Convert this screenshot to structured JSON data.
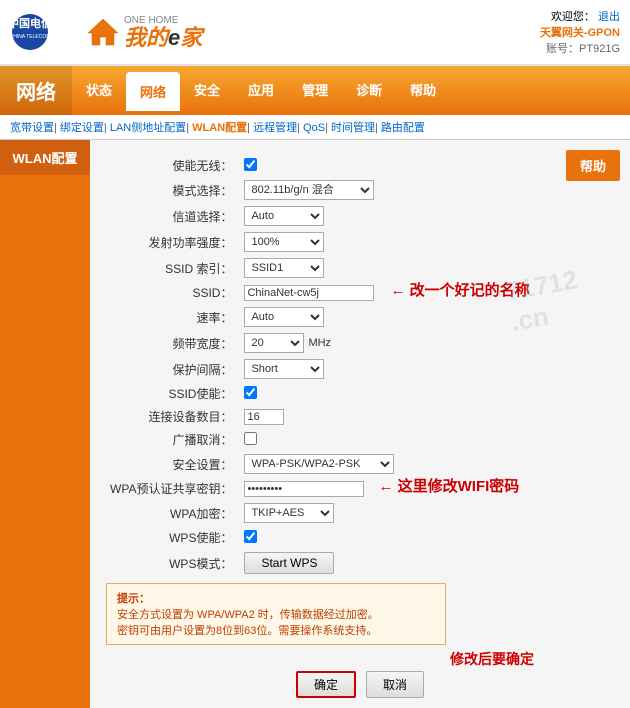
{
  "header": {
    "welcome": "欢迎您：",
    "logout": "退出",
    "gateway_label": "天翼网关-GPON",
    "account_label": "账号：PT921G"
  },
  "logo": {
    "telecom_name": "CHINA TELECOM",
    "home_text": "我的e家",
    "home_sub": "ONE HOME"
  },
  "nav": {
    "title": "网络",
    "items": [
      "状态",
      "网络",
      "安全",
      "应用",
      "管理",
      "诊断",
      "帮助"
    ]
  },
  "subnav": {
    "items": [
      "宽带设置",
      "绑定设置",
      "LAN侧地址配置",
      "WLAN配置",
      "远程管理",
      "QoS",
      "时间管理",
      "路由配置"
    ]
  },
  "sidebar": {
    "title": "WLAN配置"
  },
  "help_btn": "帮助",
  "form": {
    "enable_wifi_label": "使能无线：",
    "mode_label": "模式选择：",
    "mode_value": "802.11b/g/n 混合",
    "channel_label": "信道选择：",
    "channel_value": "Auto",
    "power_label": "发射功率强度：",
    "power_value": "100%",
    "ssid_index_label": "SSID 索引：",
    "ssid_index_value": "SSID1",
    "ssid_label": "SSID：",
    "ssid_value": "ChinaNet-cw5j",
    "rate_label": "速率：",
    "rate_value": "Auto",
    "bandwidth_label": "频带宽度：",
    "bandwidth_value": "20",
    "bandwidth_unit": "MHz",
    "guard_label": "保护间隔：",
    "guard_value": "Short",
    "ssid_enable_label": "SSID使能：",
    "connect_limit_label": "连接设备数目：",
    "connect_limit_value": "16",
    "broadcast_label": "广播取消：",
    "security_label": "安全设置：",
    "security_value": "WPA-PSK/WPA2-PSK",
    "wpa_key_label": "WPA预认证共享密钥：",
    "wpa_key_value": "●●●●●●●●",
    "wpa_encrypt_label": "WPA加密：",
    "wpa_encrypt_value": "TKIP+AES",
    "wps_enable_label": "WPS使能：",
    "wps_mode_label": "WPS模式：",
    "wps_mode_btn": "Start WPS"
  },
  "annotations": {
    "change_name": "改一个好记的名称",
    "change_wifi_password": "这里修改WIFI密码",
    "confirm_after_change": "修改后要确定"
  },
  "hint": {
    "title": "提示：",
    "line1": "安全方式设置为 WPA/WPA2 时，传输数据经过加密。",
    "line2": "密钥可由用户设置为8位到63位。需要操作系统支持。"
  },
  "buttons": {
    "confirm": "确定",
    "cancel": "取消"
  },
  "watermark": "71712\n.cn"
}
